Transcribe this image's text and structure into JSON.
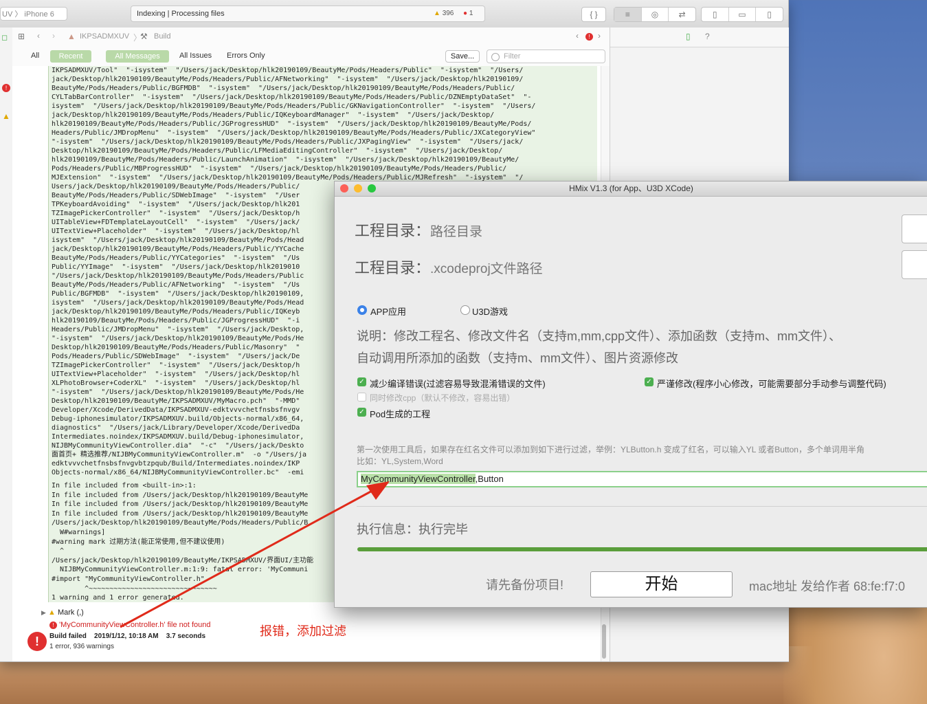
{
  "xcode": {
    "scheme_label": "UV 〉 iPhone 6",
    "activity_text": "Indexing | Processing files",
    "warnings_count": "396",
    "errors_count": "1",
    "breadcrumb_project": "IKPSADMXUV",
    "breadcrumb_build": "Build",
    "filters": {
      "all": "All",
      "recent": "Recent",
      "all_messages": "All Messages",
      "all_issues": "All Issues",
      "errors_only": "Errors Only",
      "save": "Save...",
      "filter_placeholder": "Filter"
    },
    "log_lines": [
      "IKPSADMXUV/Tool\"  \"-isystem\"  \"/Users/jack/Desktop/hlk20190109/BeautyMe/Pods/Headers/Public\"  \"-isystem\"  \"/Users/",
      "jack/Desktop/hlk20190109/BeautyMe/Pods/Headers/Public/AFNetworking\"  \"-isystem\"  \"/Users/jack/Desktop/hlk20190109/",
      "BeautyMe/Pods/Headers/Public/BGFMDB\"  \"-isystem\"  \"/Users/jack/Desktop/hlk20190109/BeautyMe/Pods/Headers/Public/",
      "CYLTabBarController\"  \"-isystem\"  \"/Users/jack/Desktop/hlk20190109/BeautyMe/Pods/Headers/Public/DZNEmptyDataSet\"  \"-",
      "isystem\"  \"/Users/jack/Desktop/hlk20190109/BeautyMe/Pods/Headers/Public/GKNavigationController\"  \"-isystem\"  \"/Users/",
      "jack/Desktop/hlk20190109/BeautyMe/Pods/Headers/Public/IQKeyboardManager\"  \"-isystem\"  \"/Users/jack/Desktop/",
      "hlk20190109/BeautyMe/Pods/Headers/Public/JGProgressHUD\"  \"-isystem\"  \"/Users/jack/Desktop/hlk20190109/BeautyMe/Pods/",
      "Headers/Public/JMDropMenu\"  \"-isystem\"  \"/Users/jack/Desktop/hlk20190109/BeautyMe/Pods/Headers/Public/JXCategoryView\"",
      "\"-isystem\"  \"/Users/jack/Desktop/hlk20190109/BeautyMe/Pods/Headers/Public/JXPagingView\"  \"-isystem\"  \"/Users/jack/",
      "Desktop/hlk20190109/BeautyMe/Pods/Headers/Public/LFMediaEditingController\"  \"-isystem\"  \"/Users/jack/Desktop/",
      "hlk20190109/BeautyMe/Pods/Headers/Public/LaunchAnimation\"  \"-isystem\"  \"/Users/jack/Desktop/hlk20190109/BeautyMe/",
      "Pods/Headers/Public/MBProgressHUD\"  \"-isystem\"  \"/Users/jack/Desktop/hlk20190109/BeautyMe/Pods/Headers/Public/",
      "MJExtension\"  \"-isystem\"  \"/Users/jack/Desktop/hlk20190109/BeautyMe/Pods/Headers/Public/MJRefresh\"  \"-isystem\"  \"/",
      "Users/jack/Desktop/hlk20190109/BeautyMe/Pods/Headers/Public/",
      "BeautyMe/Pods/Headers/Public/SDWebImage\"  \"-isystem\"  \"/User",
      "TPKeyboardAvoiding\"  \"-isystem\"  \"/Users/jack/Desktop/hlk201",
      "TZImagePickerController\"  \"-isystem\"  \"/Users/jack/Desktop/h",
      "UITableView+FDTemplateLayoutCell\"  \"-isystem\"  \"/Users/jack/",
      "UITextView+Placeholder\"  \"-isystem\"  \"/Users/jack/Desktop/hl",
      "isystem\"  \"/Users/jack/Desktop/hlk20190109/BeautyMe/Pods/Head",
      "jack/Desktop/hlk20190109/BeautyMe/Pods/Headers/Public/YYCache",
      "BeautyMe/Pods/Headers/Public/YYCategories\"  \"-isystem\"  \"/Us",
      "Public/YYImage\"  \"-isystem\"  \"/Users/jack/Desktop/hlk2019010",
      "\"/Users/jack/Desktop/hlk20190109/BeautyMe/Pods/Headers/Public",
      "BeautyMe/Pods/Headers/Public/AFNetworking\"  \"-isystem\"  \"/Us",
      "Public/BGFMDB\"  \"-isystem\"  \"/Users/jack/Desktop/hlk20190109,",
      "isystem\"  \"/Users/jack/Desktop/hlk20190109/BeautyMe/Pods/Head",
      "jack/Desktop/hlk20190109/BeautyMe/Pods/Headers/Public/IQKeyb",
      "hlk20190109/BeautyMe/Pods/Headers/Public/JGProgressHUD\"  \"-i",
      "Headers/Public/JMDropMenu\"  \"-isystem\"  \"/Users/jack/Desktop,",
      "\"-isystem\"  \"/Users/jack/Desktop/hlk20190109/BeautyMe/Pods/He",
      "Desktop/hlk20190109/BeautyMe/Pods/Headers/Public/Masonry\"  \"",
      "Pods/Headers/Public/SDWebImage\"  \"-isystem\"  \"/Users/jack/De",
      "TZImagePickerController\"  \"-isystem\"  \"/Users/jack/Desktop/h",
      "UITextView+Placeholder\"  \"-isystem\"  \"/Users/jack/Desktop/hl",
      "XLPhotoBrowser+CoderXL\"  \"-isystem\"  \"/Users/jack/Desktop/hl",
      "\"-isystem\"  \"/Users/jack/Desktop/hlk20190109/BeautyMe/Pods/He",
      "Desktop/hlk20190109/BeautyMe/IKPSADMXUV/MyMacro.pch\"  \"-MMD\"",
      "Developer/Xcode/DerivedData/IKPSADMXUV-edktvvvchetfnsbsfnvgv",
      "Debug-iphonesimulator/IKPSADMXUV.build/Objects-normal/x86_64,",
      "diagnostics\"  \"/Users/jack/Library/Developer/Xcode/DerivedDa",
      "Intermediates.noindex/IKPSADMXUV.build/Debug-iphonesimulator,",
      "NIJBMyCommunityViewController.dia\"  \"-c\"  \"/Users/jack/Deskto",
      "面首页+ 精选推荐/NIJBMyCommunityViewController.m\"  -o \"/Users/ja",
      "edktvvvchetfnsbsfnvgvbtzpqub/Build/Intermediates.noindex/IKP",
      "Objects-normal/x86_64/NIJBMyCommunityViewController.bc\"  -emi"
    ],
    "log_tail": [
      "In file included from <built-in>:1:",
      "In file included from /Users/jack/Desktop/hlk20190109/BeautyMe",
      "In file included from /Users/jack/Desktop/hlk20190109/BeautyMe",
      "In file included from /Users/jack/Desktop/hlk20190109/BeautyMe",
      "/Users/jack/Desktop/hlk20190109/BeautyMe/Pods/Headers/Public/B",
      "  W#warnings]",
      "#warning mark 过期方法(能正常使用,但不建议使用)",
      "  ^",
      "/Users/jack/Desktop/hlk20190109/BeautyMe/IKPSADMXUV/界面UI/主功能",
      "  NIJBMyCommunityViewController.m:1:9: fatal error: 'MyCommuni",
      "#import \"MyCommunityViewController.h\"",
      "        ^~~~~~~~~~~~~~~~~~~~~~~~~~~~~~~~",
      "1 warning and 1 error generated."
    ],
    "mark_row": "Mark (,)",
    "error_file": "'MyCommunityViewController.h' file not found",
    "build_status": "Build failed",
    "build_time": "2019/1/12, 10:18 AM",
    "build_duration": "3.7 seconds",
    "build_summary": "1 error, 936 warnings"
  },
  "hmix": {
    "title": "HMix V1.3 (for App、U3D XCode)",
    "project_dir_label": "工程目录：",
    "project_dir_value": "路径目录",
    "xcodeproj_label": "工程目录：",
    "xcodeproj_value": ".xcodeproj文件路径",
    "radio_app": "APP应用",
    "radio_u3d": "U3D游戏",
    "desc_line1": "说明：修改工程名、修改文件名（支持m,mm,cpp文件）、添加函数（支持m、mm文件）、",
    "desc_line2": "自动调用所添加的函数（支持m、mm文件）、图片资源修改",
    "check_reduce": "减少编译错误(过滤容易导致混淆错误的文件)",
    "check_strict": "严谨修改(程序小心修改，可能需要部分手动参与调整代码)",
    "check_cpp": "同时修改cpp（默认不修改，容易出错）",
    "check_pod": "Pod生成的工程",
    "hint_line1": "第一次使用工具后，如果存在红名文件可以添加到如下进行过滤，举例：YLButton.h 变成了红名，可以输入YL 或者Button，多个单词用半角",
    "hint_line2": "比如：YL,System,Word",
    "filter_highlight": "MyCommunityViewController",
    "filter_rest": ",Button",
    "exec_label": "执行信息：",
    "exec_value": "执行完毕",
    "progress_percent": 100,
    "backup_notice": "请先备份项目!",
    "start_button": "开始",
    "mac_label": "mac地址 发给作者  68:fe:f7:0"
  },
  "annotation": {
    "text": "报错，添加过滤"
  },
  "colors": {
    "accent_green": "#5a9e3b",
    "error_red": "#e02a1a",
    "highlight": "#b9e0a8"
  }
}
